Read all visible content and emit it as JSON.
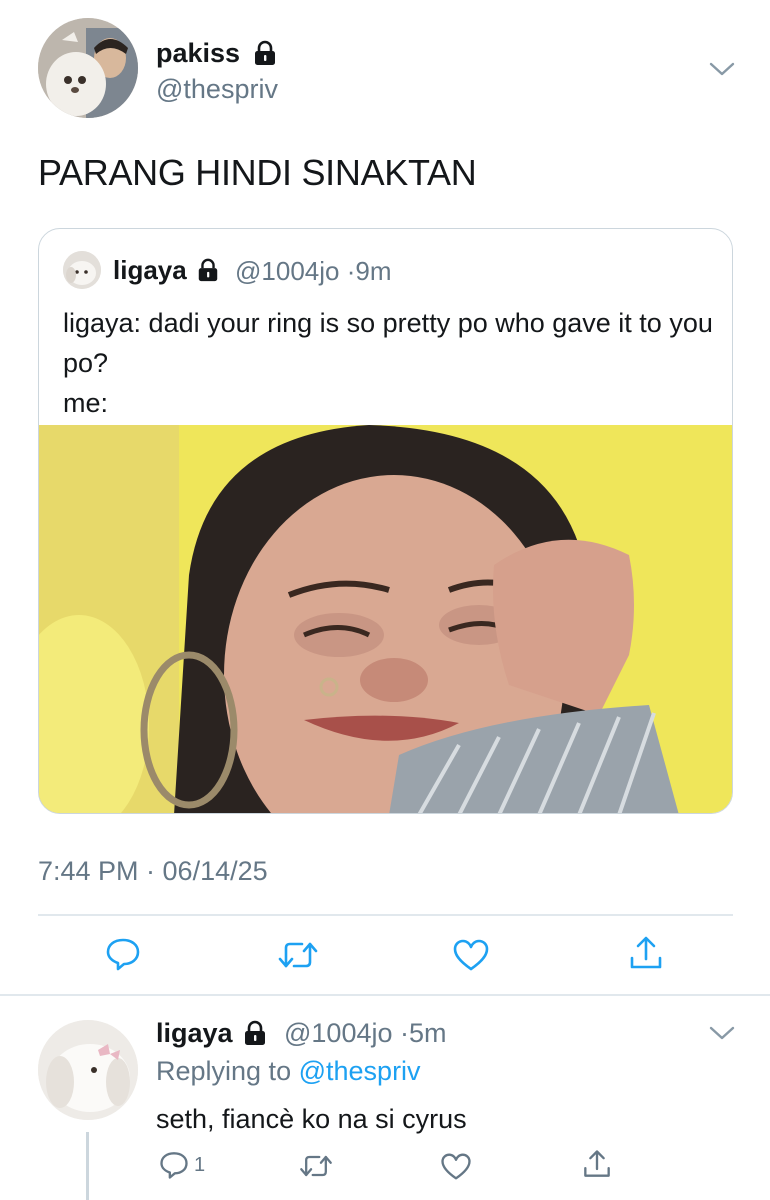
{
  "tweet": {
    "display_name": "pakiss",
    "handle": "@thespriv",
    "text": "PARANG HINDI SINAKTAN",
    "timestamp": "7:44 PM · 06/14/25"
  },
  "quoted": {
    "display_name": "ligaya",
    "handle": "@1004jo",
    "separator": "·",
    "time": "9m",
    "text_line1": "ligaya: dadi your ring is so pretty po who gave it to you po?",
    "text_line2": "me:"
  },
  "reply": {
    "display_name": "ligaya",
    "handle": "@1004jo",
    "separator": "·",
    "time": "5m",
    "replying_prefix": "Replying to",
    "replying_handle": "@thespriv",
    "text": "seth, fiancè ko na si cyrus",
    "reply_count": "1"
  },
  "icons": [
    "lock-icon",
    "chevron-down-icon",
    "reply-icon",
    "retweet-icon",
    "like-icon",
    "share-icon"
  ],
  "colors": {
    "text": "#14171a",
    "secondary": "#657786",
    "link": "#1da1f2",
    "border": "#ccd6dd"
  }
}
